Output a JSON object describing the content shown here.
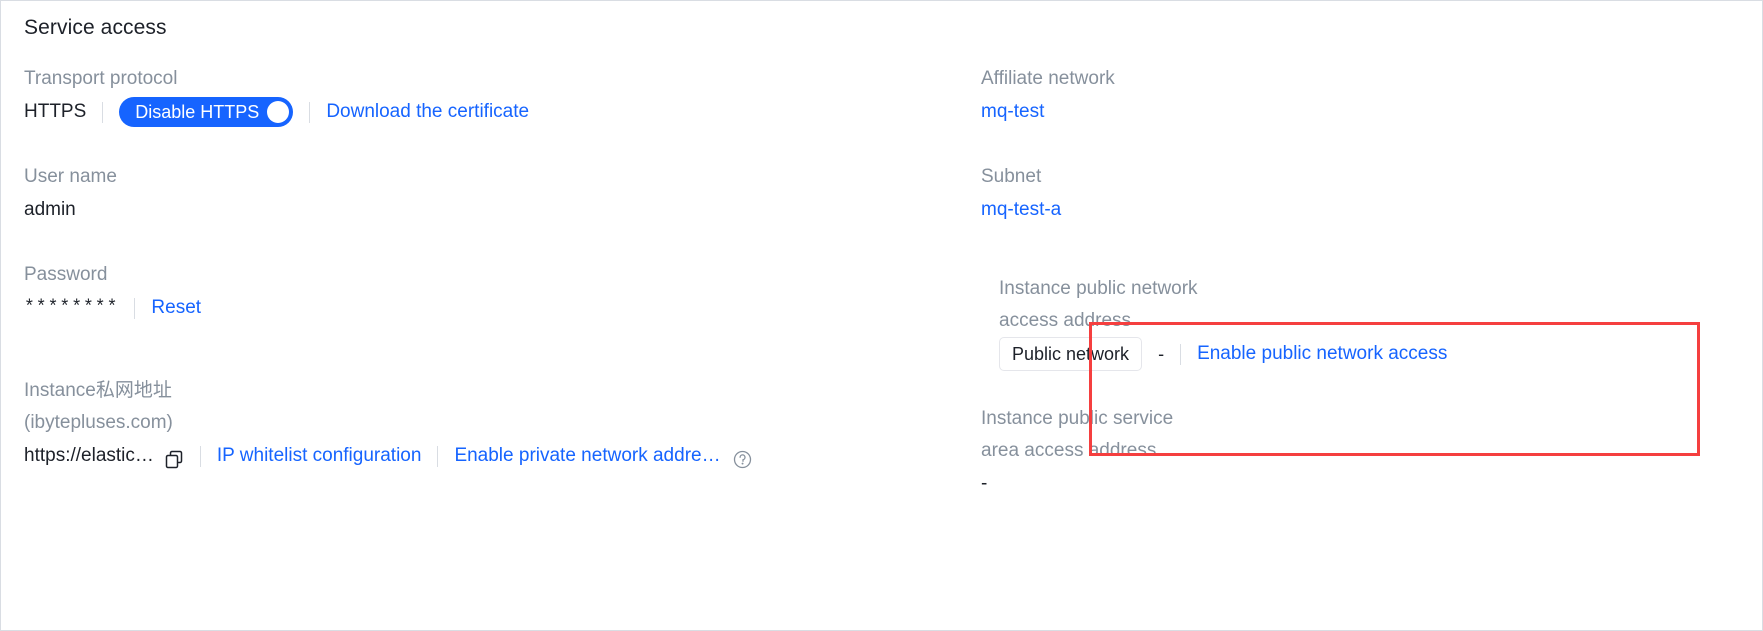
{
  "panel": {
    "title": "Service access"
  },
  "left": {
    "transport_protocol": {
      "label": "Transport protocol",
      "value": "HTTPS",
      "toggle_label": "Disable HTTPS",
      "download_link": "Download the certificate"
    },
    "user_name": {
      "label": "User name",
      "value": "admin"
    },
    "password": {
      "label": "Password",
      "value": "********",
      "reset_link": "Reset"
    },
    "private_address": {
      "label_line1": "Instance私网地址",
      "label_line2": "(ibytepluses.com)",
      "value": "https://elastic…",
      "copy_icon": "copy-icon",
      "whitelist_link": "IP whitelist configuration",
      "enable_private_link": "Enable private network addre…",
      "help_icon": "question-circle-icon"
    }
  },
  "right": {
    "affiliate_network": {
      "label": "Affiliate network",
      "value": "mq-test"
    },
    "subnet": {
      "label": "Subnet",
      "value": "mq-test-a"
    },
    "public_network_access": {
      "label_line1": "Instance public network",
      "label_line2": "access address",
      "tag": "Public network",
      "value": "-",
      "enable_link": "Enable public network access"
    },
    "public_service_area": {
      "label_line1": "Instance public service",
      "label_line2": "area access address",
      "value": "-"
    }
  },
  "colors": {
    "accent": "#1664ff",
    "highlight": "#f53f3f",
    "label": "#86909c",
    "text": "#1d2129"
  }
}
